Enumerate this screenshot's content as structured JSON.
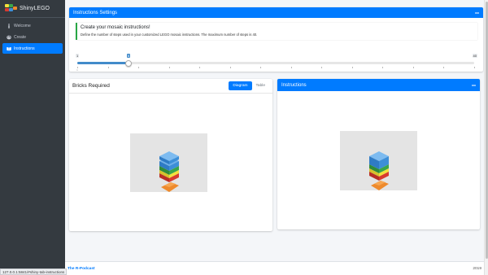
{
  "brand": {
    "name": "ShinyLEGO"
  },
  "sidebar": {
    "items": [
      {
        "label": "Welcome",
        "icon": "info-icon"
      },
      {
        "label": "Create",
        "icon": "palette-icon"
      },
      {
        "label": "Instructions",
        "icon": "book-icon",
        "active": true
      }
    ]
  },
  "status_bar": {
    "url": "127.0.0.1:5841/#shiny-tab-instructions"
  },
  "settings": {
    "title": "Instructions Settings",
    "callout_title": "Create your mosaic instructions!",
    "callout_text": "Define the number of steps used in your customized LEGO mosaic instructions. The maximum number of steps is 40.",
    "slider": {
      "min_label": "1",
      "max_label": "40",
      "value_label": "6",
      "value": 6,
      "min": 1,
      "max": 40,
      "tick_labels": [
        "1",
        "",
        "",
        "",
        "",
        "",
        "",
        "",
        "",
        "",
        "",
        "",
        "",
        ""
      ]
    }
  },
  "bricks": {
    "title": "Bricks Required",
    "tabs": [
      {
        "label": "Diagram",
        "active": true
      },
      {
        "label": "Table",
        "active": false
      }
    ]
  },
  "instructions": {
    "title": "Instructions"
  },
  "footer": {
    "link": "The R-Podcast",
    "year": "2019"
  },
  "colors": {
    "primary": "#007bff",
    "sidebar": "#343a40",
    "callout_border": "#28a745",
    "brick_blue": "#3d8fd8",
    "brick_green": "#3aa64a",
    "brick_yellow": "#f3e03b",
    "brick_red": "#d83a2f",
    "brick_orange": "#ee8a2c"
  }
}
